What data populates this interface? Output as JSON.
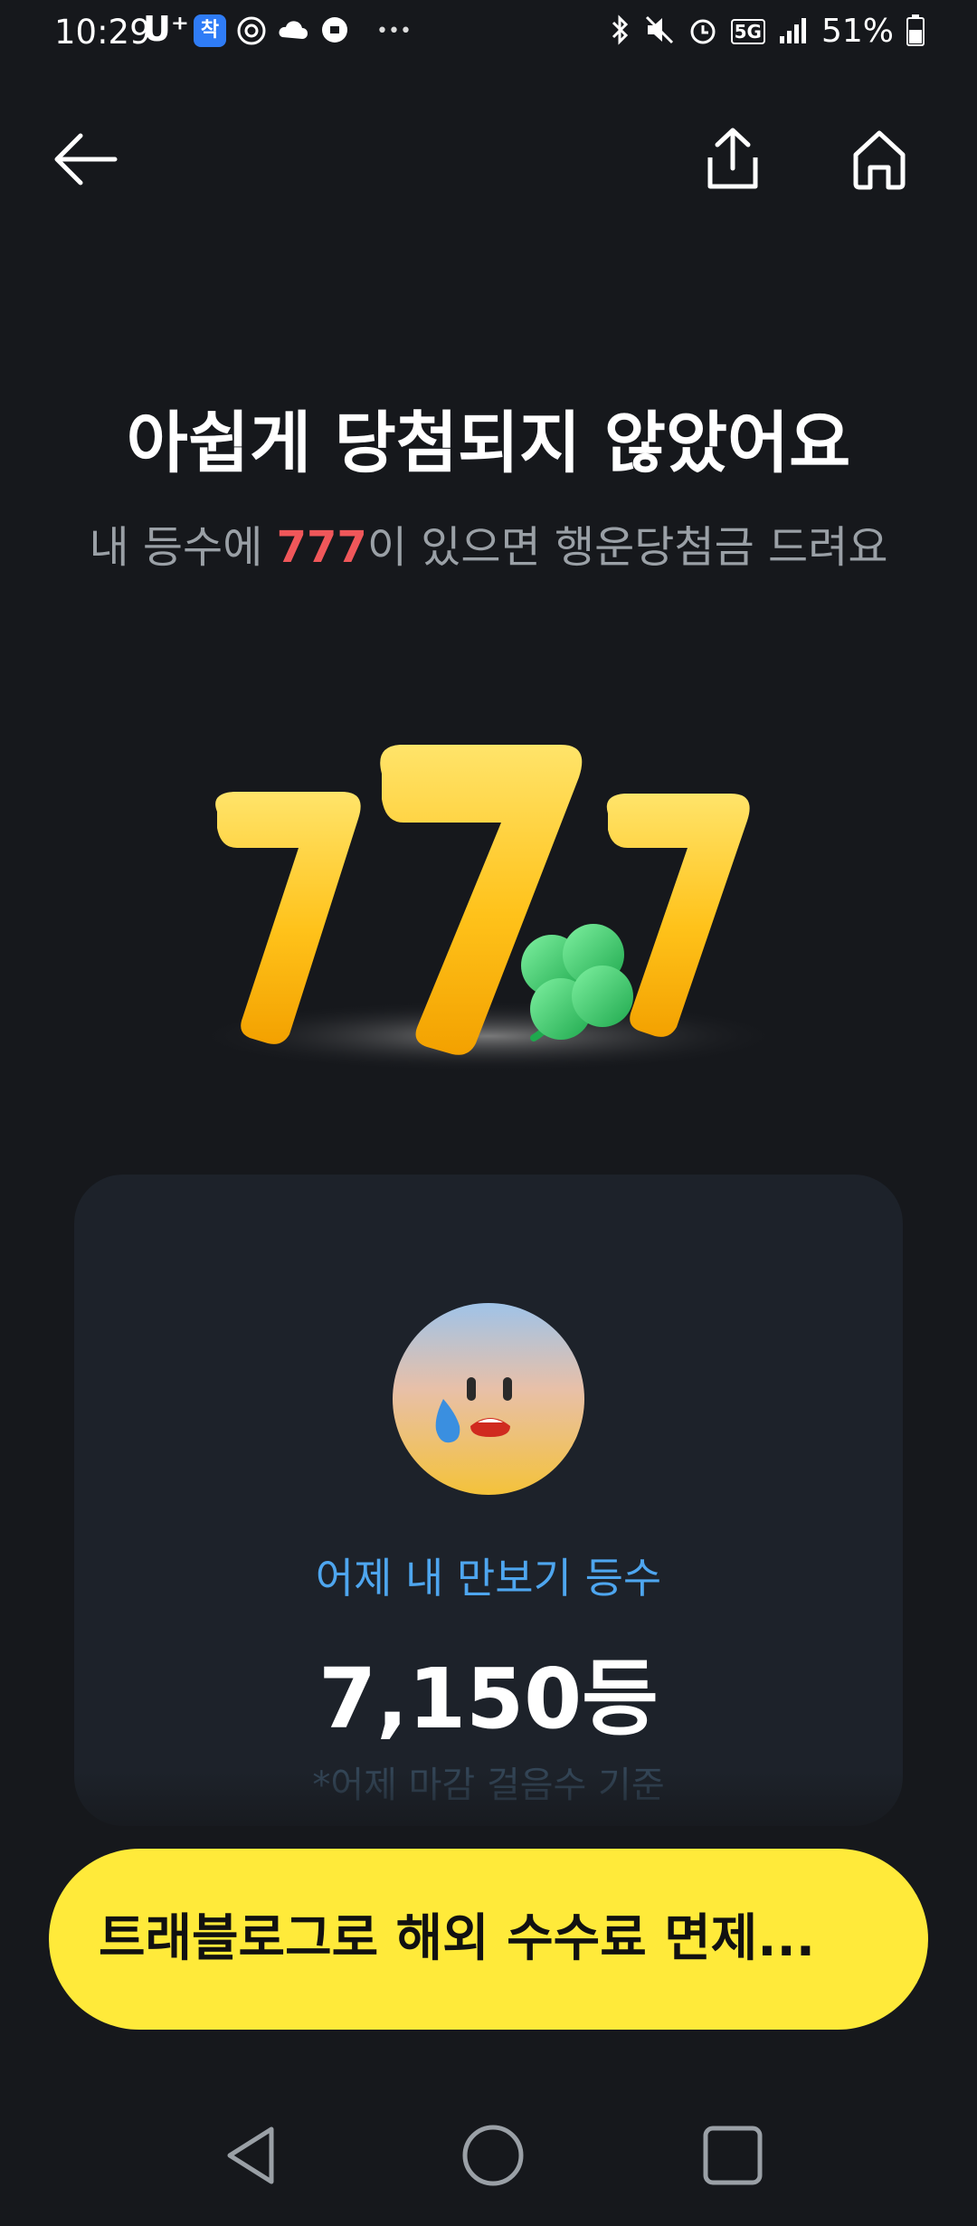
{
  "status_bar": {
    "time": "10:29",
    "carrier": "U⁺",
    "app_badge": "착",
    "more": "•••",
    "battery": "51%",
    "network": "5G"
  },
  "nav": {
    "back_icon": "arrow-left-icon",
    "share_icon": "share-icon",
    "home_icon": "home-icon"
  },
  "result": {
    "title": "아쉽게 당첨되지 않았어요",
    "subtitle_prefix": "내 등수에 ",
    "subtitle_highlight": "777",
    "subtitle_suffix": "이 있으면 행운당첨금 드려요",
    "highlight_color": "#f0575a"
  },
  "rank_card": {
    "label": "어제 내 만보기 등수",
    "rank": "7,150등",
    "note": "*어제 마감 걸음수 기준"
  },
  "banner": {
    "text": "트래블로그로 해외 수수료 면제...",
    "color": "#ffea3a"
  }
}
